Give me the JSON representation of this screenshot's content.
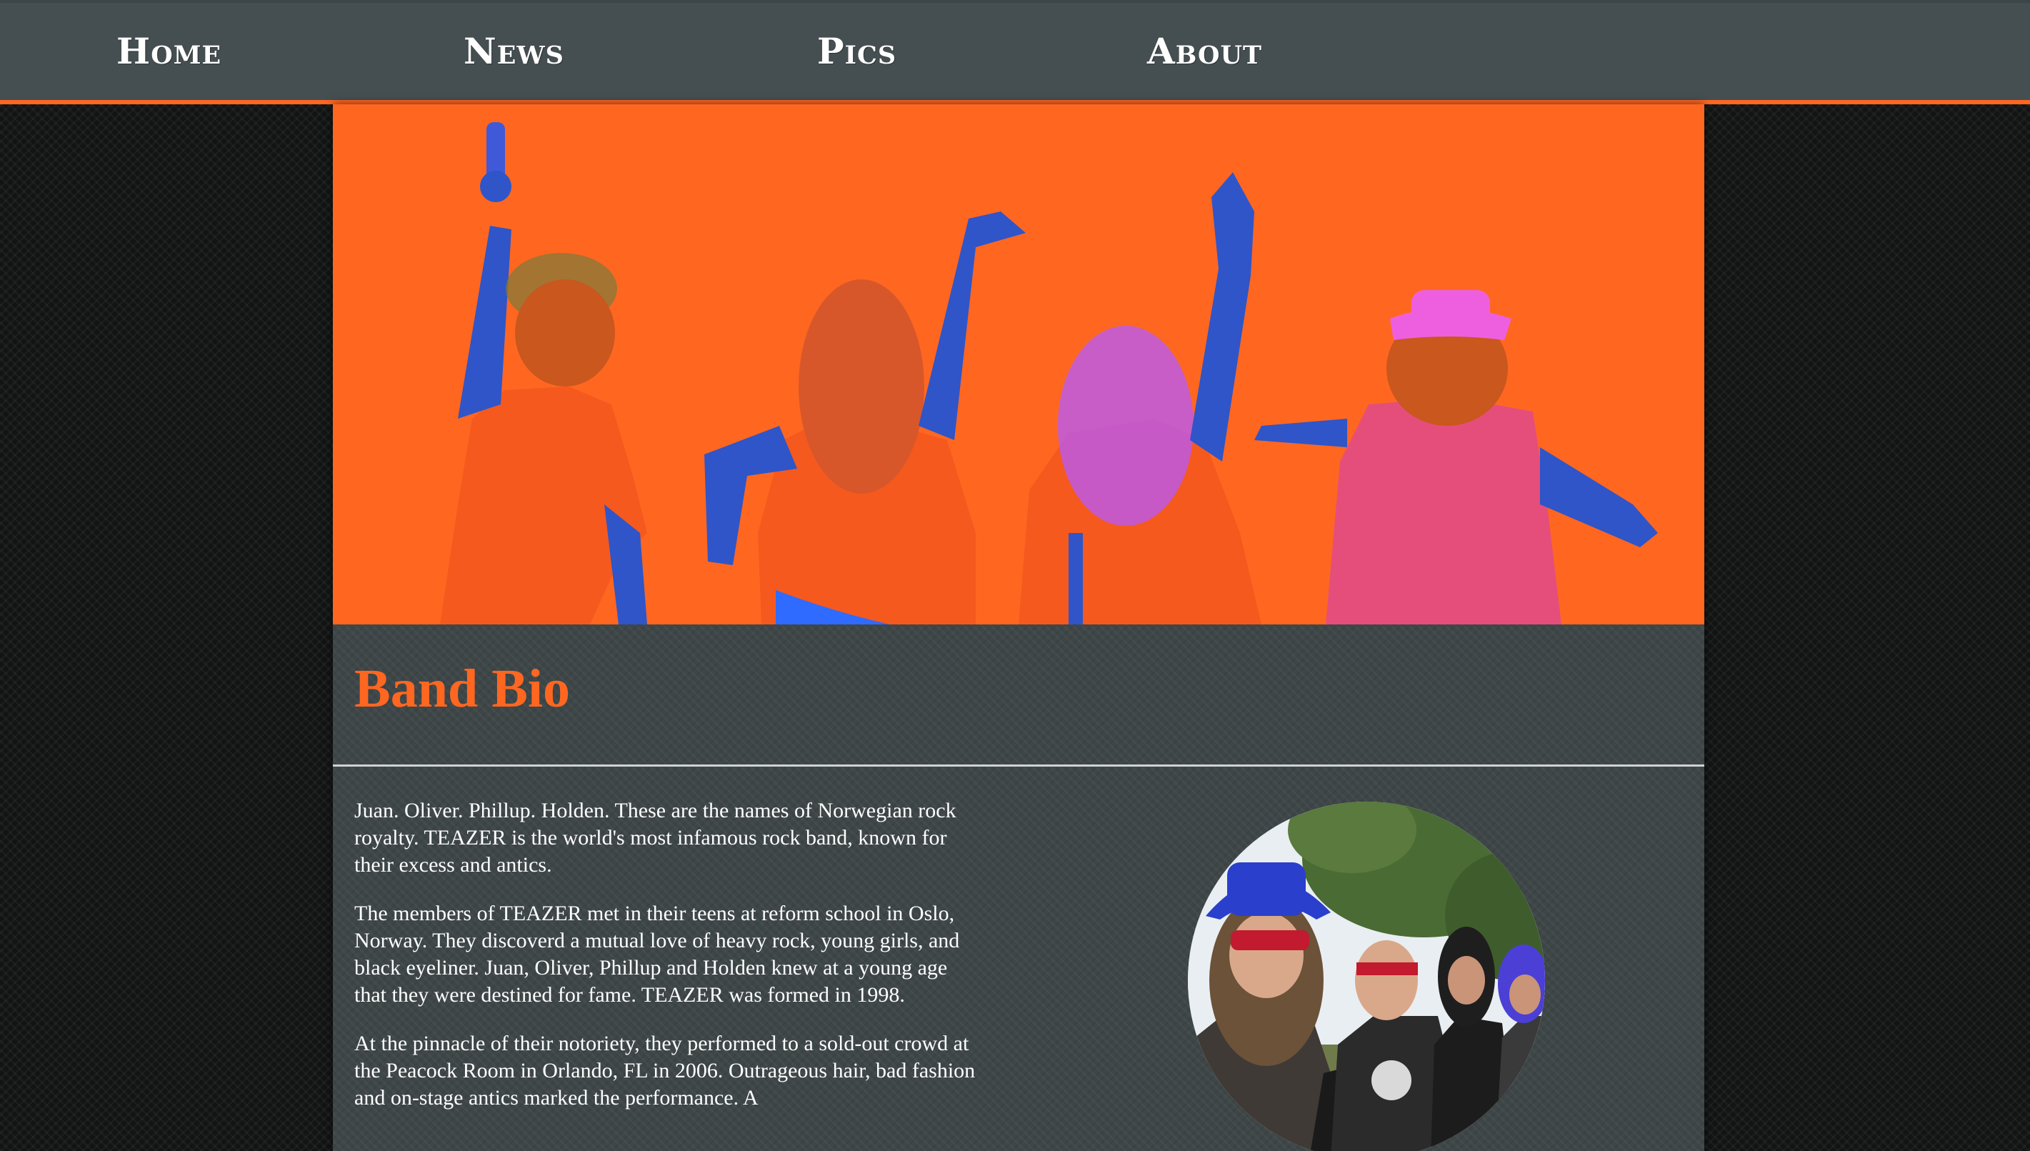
{
  "nav": {
    "items": [
      {
        "label": "Home"
      },
      {
        "label": "News"
      },
      {
        "label": "Pics"
      },
      {
        "label": "About"
      }
    ]
  },
  "main": {
    "title": "Band Bio",
    "paragraphs": [
      "Juan. Oliver. Phillup. Holden. These are the names of Norwegian rock royalty. TEAZER is the world's most infamous rock band, known for their excess and antics.",
      "The members of TEAZER met in their teens at reform school in Oslo, Norway. They discoverd a mutual love of heavy rock, young girls, and black eyeliner. Juan, Oliver, Phillup and Holden knew at a young age that they were destined for fame. TEAZER was formed in 1998.",
      "At the pinnacle of their notoriety, they performed to a sold-out crowd at the Peacock Room in Orlando, FL in 2006. Outrageous hair, bad fashion and on-stage antics marked the performance. A"
    ]
  },
  "colors": {
    "accent": "#ff6721",
    "nav_bg": "#454f51",
    "main_bg": "#3e4648",
    "page_bg": "#121414",
    "text": "#ffffff"
  },
  "images": {
    "hero": "band-members-duotone-hero",
    "band_photo": "band-members-circle-photo"
  }
}
